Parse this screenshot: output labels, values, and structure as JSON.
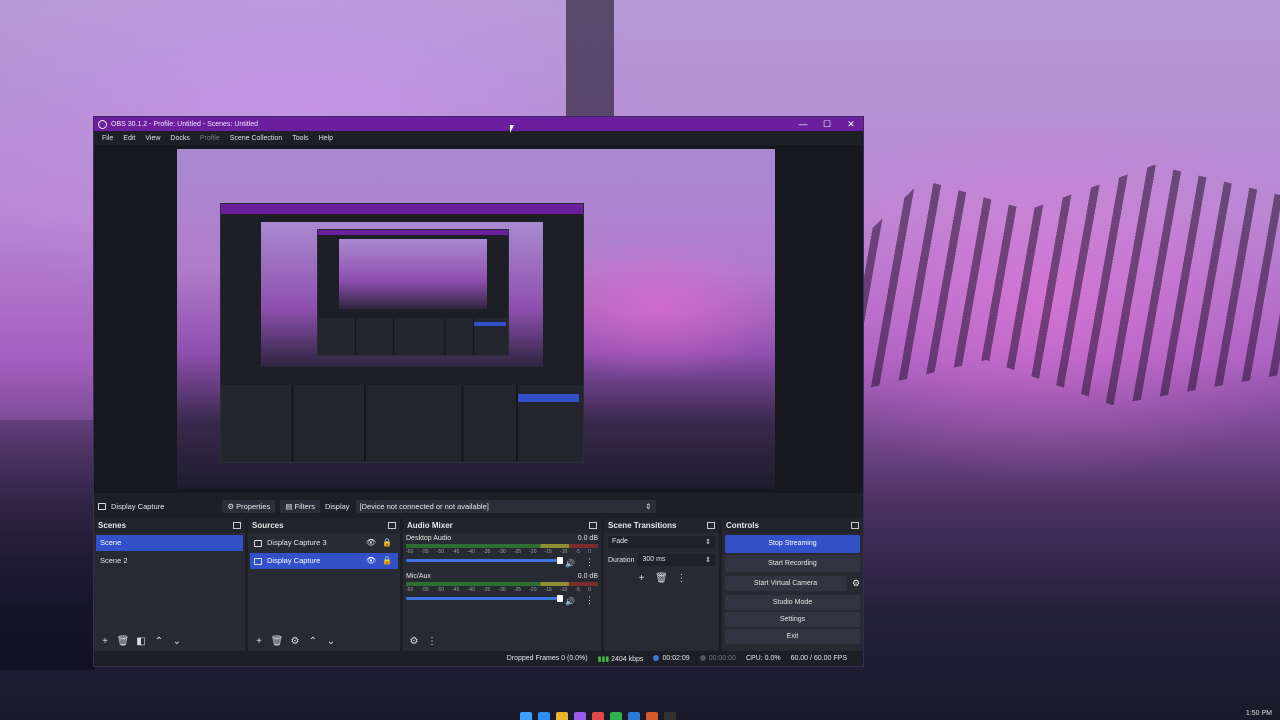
{
  "window": {
    "title": "OBS 30.1.2 - Profile: Untitled - Scenes: Untitled",
    "controls": [
      "—",
      "☐",
      "✕"
    ]
  },
  "menu": [
    "File",
    "Edit",
    "View",
    "Docks",
    "Profile",
    "Scene Collection",
    "Tools",
    "Help"
  ],
  "source_toolbar": {
    "source_name": "Display Capture",
    "properties": "Properties",
    "filters": "Filters",
    "display_label": "Display",
    "display_value": "[Device not connected or not available]"
  },
  "scenes": {
    "header": "Scenes",
    "items": [
      "Scene",
      "Scene 2"
    ],
    "selected": 0
  },
  "sources": {
    "header": "Sources",
    "items": [
      "Display Capture 3",
      "Display Capture"
    ],
    "selected": 1
  },
  "audio_mixer": {
    "header": "Audio Mixer",
    "channels": [
      {
        "name": "Desktop Audio",
        "db": "0.0 dB",
        "volume": 1.0
      },
      {
        "name": "Mic/Aux",
        "db": "0.0 dB",
        "volume": 1.0
      }
    ],
    "ticks": [
      "-60",
      "-55",
      "-50",
      "-45",
      "-40",
      "-35",
      "-30",
      "-25",
      "-20",
      "-15",
      "-10",
      "-5",
      "0"
    ]
  },
  "scene_transitions": {
    "header": "Scene Transitions",
    "transition": "Fade",
    "duration_label": "Duration",
    "duration_value": "300 ms"
  },
  "controls": {
    "header": "Controls",
    "stop_streaming": "Stop Streaming",
    "start_recording": "Start Recording",
    "start_virtual_camera": "Start Virtual Camera",
    "studio_mode": "Studio Mode",
    "settings": "Settings",
    "exit": "Exit"
  },
  "status": {
    "dropped_frames": "Dropped Frames 0 (0.0%)",
    "bitrate": "2404 kbps",
    "stream_time": "00:02:09",
    "rec_time": "00:00:00",
    "cpu": "CPU: 0.0%",
    "fps": "60.00 / 60.00 FPS"
  },
  "taskbar": {
    "clock": "1:50 PM"
  },
  "colors": {
    "titlebar": "#6b1f9e",
    "accent": "#3251c9",
    "panel": "#272a33"
  }
}
